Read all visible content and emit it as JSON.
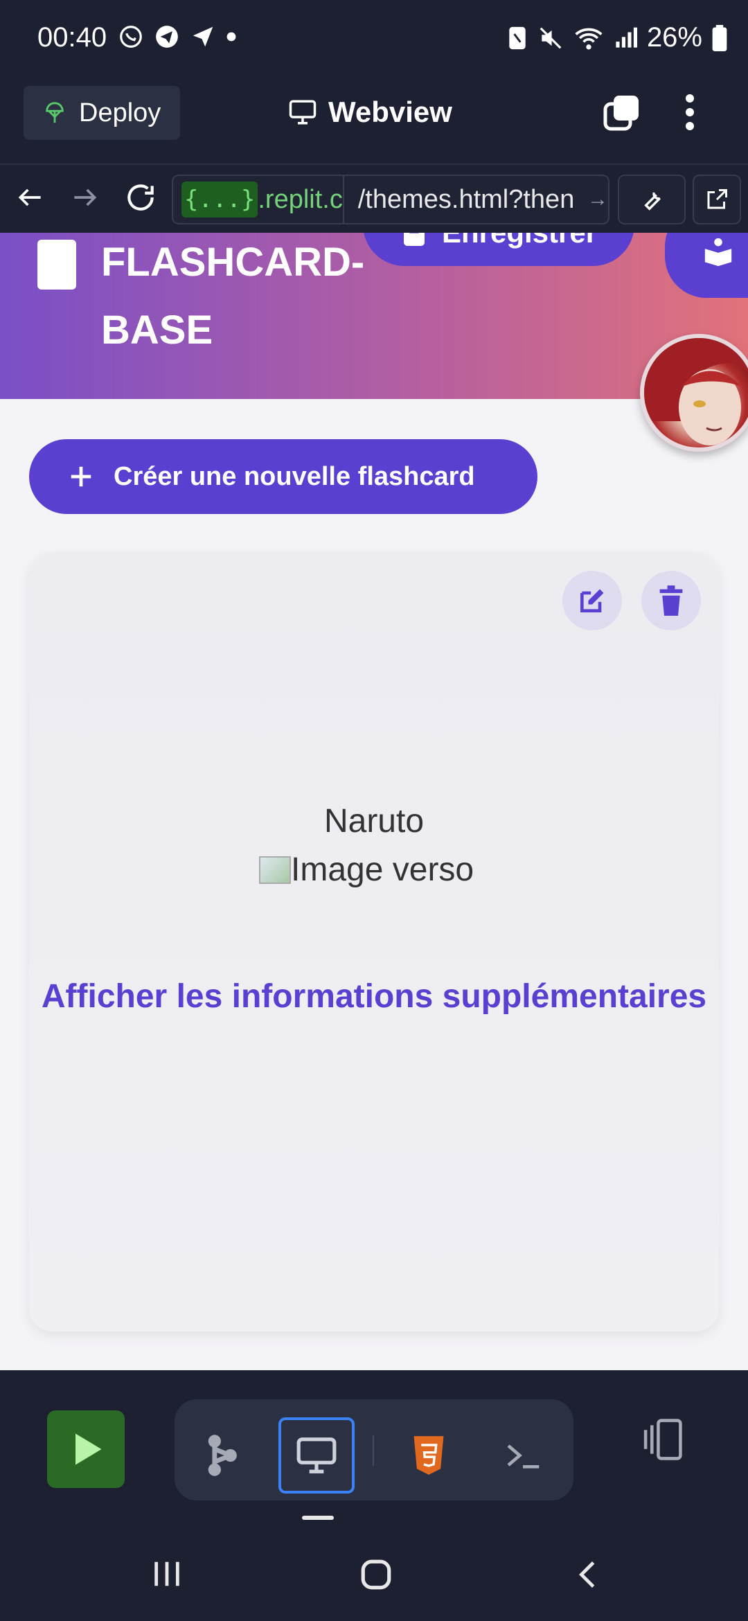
{
  "status_bar": {
    "time": "00:40",
    "battery": "26%",
    "icons_left": [
      "whatsapp-icon",
      "telegram-icon",
      "send-icon",
      "dot-icon"
    ],
    "icons_right": [
      "nfc-icon",
      "mute-icon",
      "wifi-icon",
      "signal-icon",
      "battery-icon"
    ]
  },
  "app_bar": {
    "deploy_label": "Deploy",
    "title": "Webview"
  },
  "url_bar": {
    "host_tag": "{...}",
    "host": ".replit.c",
    "path": "/themes.html?then"
  },
  "webview": {
    "hero": {
      "title": "FLASHCARD-BASE",
      "save_label": "Enregistrer"
    },
    "create_button_label": "Créer une nouvelle flashcard",
    "card": {
      "front_text": "Naruto",
      "image_alt": "Image verso",
      "more_info_label": "Afficher les informations supplémentaires"
    }
  },
  "colors": {
    "accent": "#5a3fd0",
    "hero_gradient_start": "#7a4fc7",
    "hero_gradient_end": "#e1727a",
    "run_button": "#2a6a25",
    "active_tool_border": "#3b82f6"
  }
}
